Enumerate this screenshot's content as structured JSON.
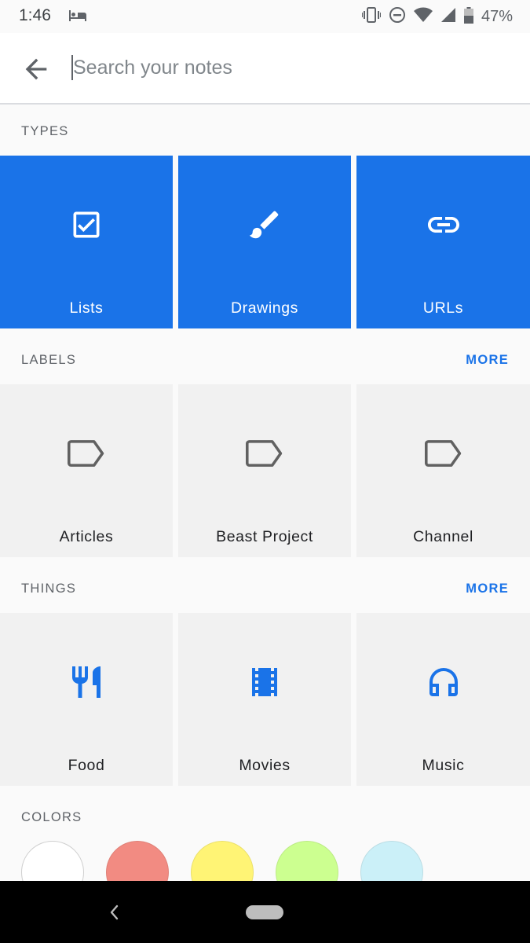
{
  "status_bar": {
    "time": "1:46",
    "battery_percent": "47%",
    "icons": [
      "sleep-icon",
      "vibrate-icon",
      "do-not-disturb-icon",
      "wifi-icon",
      "signal-icon",
      "battery-icon"
    ]
  },
  "search": {
    "placeholder": "Search your notes",
    "value": ""
  },
  "types": {
    "title": "TYPES",
    "items": [
      {
        "label": "Lists",
        "icon": "checkbox-icon"
      },
      {
        "label": "Drawings",
        "icon": "brush-icon"
      },
      {
        "label": "URLs",
        "icon": "link-icon"
      }
    ]
  },
  "labels": {
    "title": "LABELS",
    "more": "MORE",
    "items": [
      {
        "label": "Articles",
        "icon": "label-icon"
      },
      {
        "label": "Beast Project",
        "icon": "label-icon"
      },
      {
        "label": "Channel",
        "icon": "label-icon"
      }
    ]
  },
  "things": {
    "title": "THINGS",
    "more": "MORE",
    "items": [
      {
        "label": "Food",
        "icon": "restaurant-icon"
      },
      {
        "label": "Movies",
        "icon": "movie-icon"
      },
      {
        "label": "Music",
        "icon": "headphones-icon"
      }
    ]
  },
  "colors": {
    "title": "COLORS",
    "swatches": [
      "#ffffff",
      "#f28b82",
      "#fff475",
      "#ccff90",
      "#cbf0f8"
    ]
  },
  "theme": {
    "accent": "#1a73e8",
    "tile_gray": "#f1f1f1"
  }
}
